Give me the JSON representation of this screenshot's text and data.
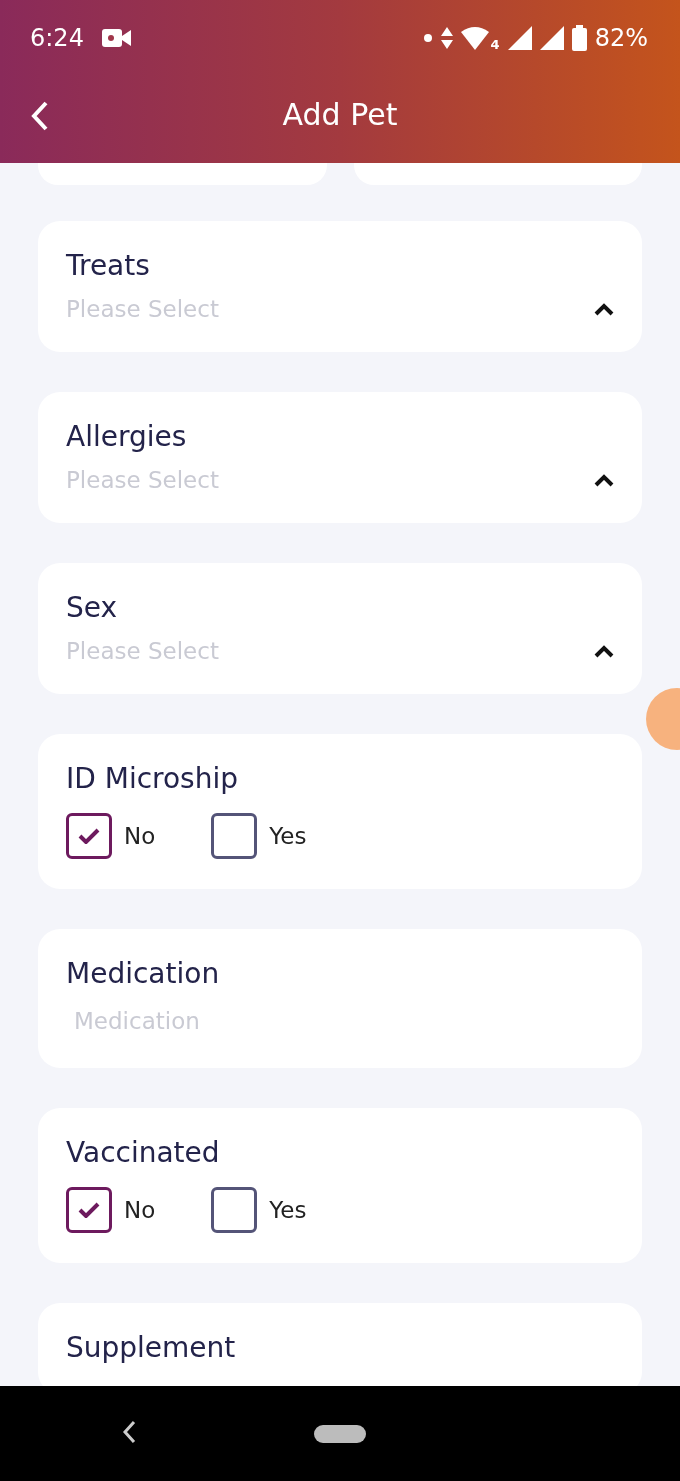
{
  "status_bar": {
    "time": "6:24",
    "network": "4",
    "battery": "82%"
  },
  "header": {
    "title": "Add Pet"
  },
  "fields": [
    {
      "kind": "select",
      "label": "Treats",
      "placeholder": "Please Select"
    },
    {
      "kind": "select",
      "label": "Allergies",
      "placeholder": "Please Select"
    },
    {
      "kind": "select",
      "label": "Sex",
      "placeholder": "Please Select"
    },
    {
      "kind": "checks",
      "label": "ID Microship",
      "options": [
        {
          "label": "No",
          "checked": true
        },
        {
          "label": "Yes",
          "checked": false
        }
      ]
    },
    {
      "kind": "text",
      "label": "Medication",
      "placeholder": "Medication"
    },
    {
      "kind": "checks",
      "label": "Vaccinated",
      "options": [
        {
          "label": "No",
          "checked": true
        },
        {
          "label": "Yes",
          "checked": false
        }
      ]
    },
    {
      "kind": "select",
      "label": "Supplement"
    }
  ]
}
